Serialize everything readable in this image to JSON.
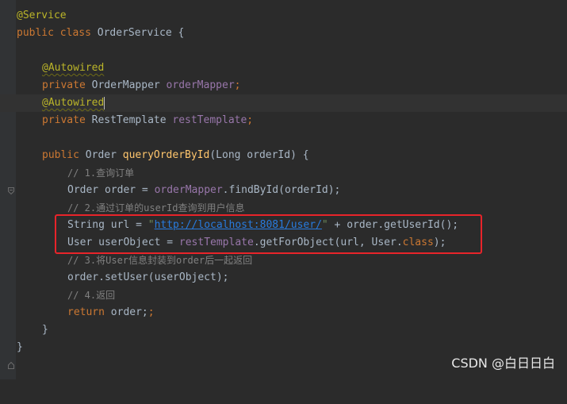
{
  "code": {
    "service_annotation": "@Service",
    "kw_public": "public",
    "kw_class": "class",
    "class_name": "OrderService",
    "open_brace": "{",
    "close_brace": "}",
    "autowired_annotation": "@Autowired",
    "kw_private": "private",
    "type_order_mapper": "OrderMapper",
    "field_order_mapper": "orderMapper",
    "type_rest_template": "RestTemplate",
    "field_rest_template": "restTemplate",
    "semicolon": ";",
    "type_order": "Order",
    "method_name": "queryOrderById",
    "params": "(Long orderId) {",
    "comment_1": "// 1.查询订单",
    "line_order_decl": "Order order = ",
    "find_call": ".findById(orderId);",
    "comment_2": "// 2.通过订单的userId查询到用户信息",
    "line_url_decl": "String url = ",
    "quote": "\"",
    "url_value": "http://localhost:8081/user/",
    "url_concat": " + order.getUserId();",
    "line_user_decl": "User userObject = ",
    "get_for_object": ".getForObject(url, User.",
    "kw_class_literal": "class",
    "get_for_object_end": ");",
    "comment_3": "// 3.将User信息封装到order后一起返回",
    "set_user_line": "order.setUser(userObject);",
    "comment_4": "// 4.返回",
    "kw_return": "return",
    "return_value": " order;"
  },
  "watermark": "CSDN @白日日白"
}
